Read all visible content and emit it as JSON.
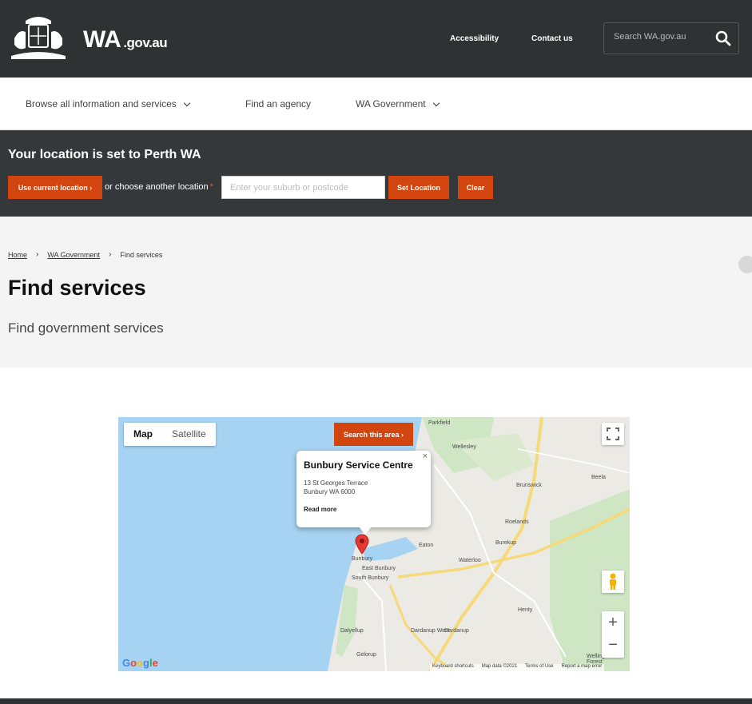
{
  "header": {
    "logo_main": "WA",
    "logo_suffix": ".gov.au",
    "links": {
      "accessibility": "Accessibility",
      "contact": "Contact us"
    },
    "search_placeholder": "Search WA.gov.au"
  },
  "nav": {
    "browse": "Browse all information and services",
    "agency": "Find an agency",
    "government": "WA Government"
  },
  "location": {
    "title": "Your location is set to Perth WA",
    "use_current": "Use current location ›",
    "or_choose": "or choose another location",
    "required_mark": "*",
    "input_placeholder": "Enter your suburb or postcode",
    "set_button": "Set Location",
    "clear_button": "Clear"
  },
  "breadcrumb": [
    "Home",
    "WA Government",
    "Find services"
  ],
  "page": {
    "title": "Find services",
    "subtitle": "Find government services"
  },
  "map": {
    "tabs": [
      "Map",
      "Satellite"
    ],
    "search_area": "Search this area ›",
    "popup": {
      "title": "Bunbury Service Centre",
      "address_line1": "13 St Georges Terrace",
      "address_line2": "Bunbury WA 6000",
      "read_more": "Read more"
    },
    "zoom_in": "+",
    "zoom_out": "−",
    "attribution": [
      "Keyboard shortcuts",
      "Map data ©2021",
      "Terms of Use",
      "Report a map error"
    ],
    "places": [
      "Parkfield",
      "Wellesley",
      "Beela",
      "Brunswick",
      "Roelands",
      "Burekup",
      "Eaton",
      "Waterloo",
      "Bunbury",
      "East Bunbury",
      "South Bunbury",
      "Gelorup",
      "Dardanup West",
      "Dardanup",
      "Henty",
      "Wellington Forest",
      "Dalyellup"
    ],
    "colors": {
      "water": "#a7d3f2",
      "land": "#eceae4",
      "green": "#cfe6c4",
      "road_major": "#f6d979",
      "accent": "#d2450f",
      "pin": "#e53935"
    }
  }
}
